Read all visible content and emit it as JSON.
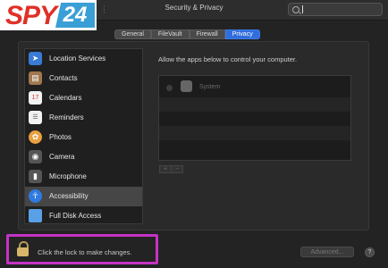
{
  "brand": {
    "part1": "SPY",
    "part2": "24"
  },
  "window": {
    "title": "Security & Privacy"
  },
  "search": {
    "placeholder": "",
    "value": ""
  },
  "tabs": [
    {
      "label": "General"
    },
    {
      "label": "FileVault"
    },
    {
      "label": "Firewall"
    },
    {
      "label": "Privacy",
      "active": true
    }
  ],
  "sidebar": {
    "items": [
      {
        "label": "Location Services",
        "icon": "location-arrow-icon",
        "color": "#3a7bd5"
      },
      {
        "label": "Contacts",
        "icon": "contacts-book-icon",
        "color": "#a07850"
      },
      {
        "label": "Calendars",
        "icon": "calendar-icon",
        "color": "#f2f2f2"
      },
      {
        "label": "Reminders",
        "icon": "reminders-list-icon",
        "color": "#f2f2f2"
      },
      {
        "label": "Photos",
        "icon": "photos-flower-icon",
        "color": "#e8a040"
      },
      {
        "label": "Camera",
        "icon": "camera-icon",
        "color": "#555555"
      },
      {
        "label": "Microphone",
        "icon": "microphone-icon",
        "color": "#555555"
      },
      {
        "label": "Accessibility",
        "icon": "accessibility-icon",
        "color": "#2f7ae0",
        "selected": true
      },
      {
        "label": "Full Disk Access",
        "icon": "folder-icon",
        "color": "#5aa0e6"
      }
    ]
  },
  "main": {
    "description": "Allow the apps below to control your computer.",
    "apps": [
      {
        "name": "System"
      }
    ],
    "add_label": "+",
    "remove_label": "−"
  },
  "footer": {
    "lock_text": "Click the lock to make changes.",
    "advanced_label": "Advanced...",
    "help_label": "?"
  },
  "colors": {
    "accent": "#2f6edc",
    "highlight": "#c433c4"
  }
}
